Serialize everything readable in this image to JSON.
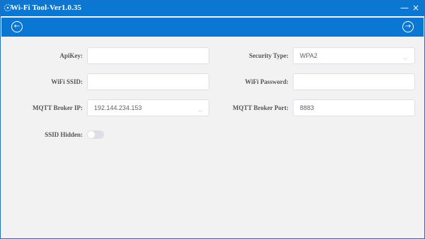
{
  "window": {
    "title": "Wi-Fi Tool-Ver1.0.35",
    "minimize": "—",
    "close": "×"
  },
  "nav": {
    "back": "←",
    "forward": "→"
  },
  "form": {
    "apikey": {
      "label": "ApiKey:",
      "value": ""
    },
    "security_type": {
      "label": "Security Type:",
      "value": "WPA2"
    },
    "wifi_ssid": {
      "label": "WiFi SSID:",
      "value": ""
    },
    "wifi_password": {
      "label": "WiFi Password:",
      "value": ""
    },
    "mqtt_ip": {
      "label": "MQTT Broker IP:",
      "value": "192.144.234.153"
    },
    "mqtt_port": {
      "label": "MQTT Broker Port:",
      "value": "8883"
    },
    "ssid_hidden": {
      "label": "SSID Hidden:",
      "enabled": false
    }
  },
  "colors": {
    "accent": "#0a78d2",
    "background": "#f2f2f2"
  }
}
